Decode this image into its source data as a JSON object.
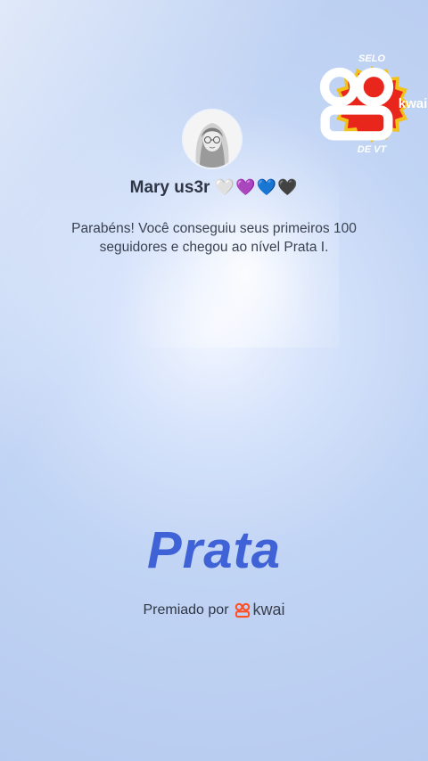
{
  "badge": {
    "top": "SELO",
    "brand": "kwai",
    "bottom": "DE VT",
    "colors": {
      "fill": "#e8261b",
      "border": "#f2c21a"
    }
  },
  "profile": {
    "name": "Mary us3r",
    "hearts": "🤍💜💙🖤"
  },
  "message": "Parabéns! Você conseguiu seus primeiros 100 seguidores e chegou ao nível Prata I.",
  "level_title": "Prata",
  "footer": {
    "prefix": "Premiado por",
    "brand": "kwai",
    "logo_icon": "kwai-logo-icon"
  },
  "colors": {
    "accent": "#3f63d6",
    "kwai_orange": "#ff4f23"
  }
}
